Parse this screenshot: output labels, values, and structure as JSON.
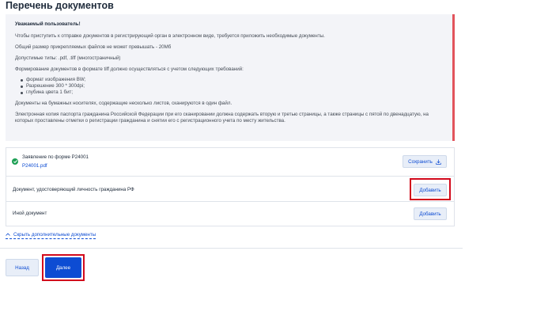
{
  "page": {
    "title": "Перечень документов"
  },
  "notice": {
    "title": "Уважаемый пользователь!",
    "p1": "Чтобы приступить к отправке документов в регистрирующий орган в электронном виде, требуется приложить необходимые документы.",
    "p2": "Общий размер прикрепляемых файлов не может превышать - 20Мб",
    "p3": "Допустимые типы: .pdf, .tiff (многостраничный)",
    "p4": "Формирование документов в формате tiff должно осуществляться с учетом следующих требований:",
    "requirements": [
      "формат изображения BW;",
      "Разрешение 300 * 300dpi;",
      "глубина цвета 1 бит;"
    ],
    "p5": "Документы на бумажных носителях, содержащие несколько листов, сканируются в один файл.",
    "p6": "Электронная копия паспорта гражданина Российской Федерации при его сканировании должна содержать вторую и третью страницы, а также страницы с пятой по двенадцатую, на которых проставлены отметки о регистрации гражданина и снятии его с регистрационного учета по месту жительства."
  },
  "documents": [
    {
      "title": "Заявление по форме Р24001",
      "file": "Р24001.pdf",
      "action": "Сохранить",
      "status": "uploaded"
    },
    {
      "title": "Документ, удостоверяющий личность гражданина РФ",
      "action": "Добавить"
    },
    {
      "title": "Иной документ",
      "action": "Добавить"
    }
  ],
  "toggle": {
    "label": "Скрыть дополнительные документы"
  },
  "footer": {
    "back_label": "Назад",
    "next_label": "Далее"
  },
  "colors": {
    "accent": "#0d4cd3",
    "success": "#1ea055",
    "notice_border": "#e2545c",
    "highlight": "#d2091c"
  }
}
